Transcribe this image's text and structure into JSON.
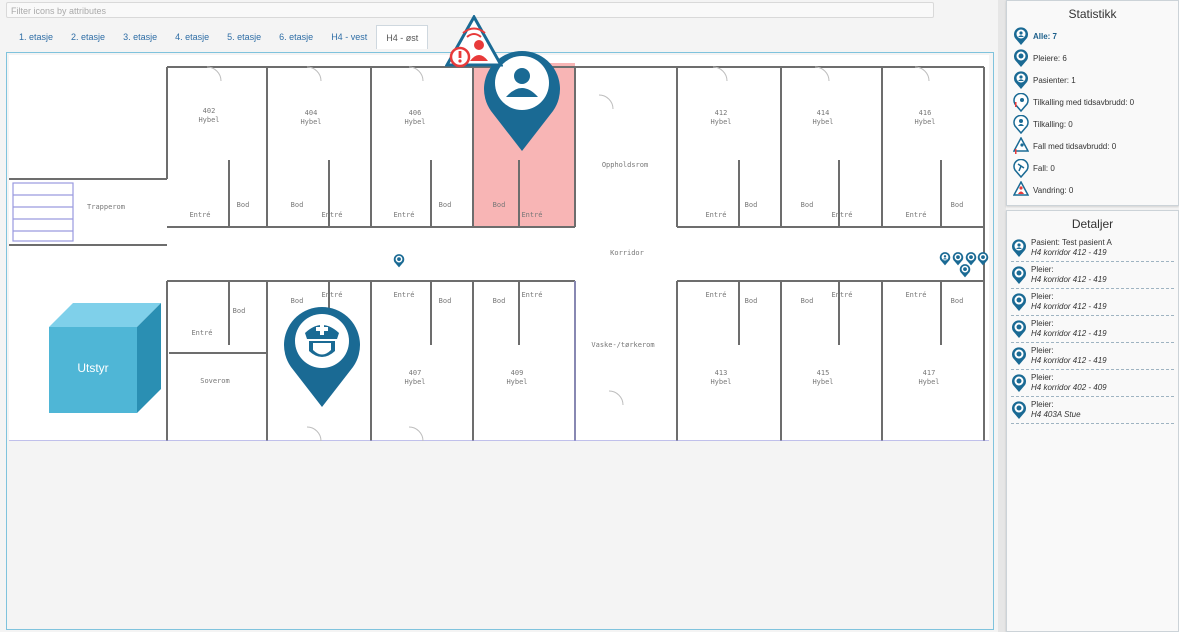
{
  "search": {
    "placeholder": "Filter icons by attributes"
  },
  "tabs": [
    {
      "label": "1. etasje",
      "active": false
    },
    {
      "label": "2. etasje",
      "active": false
    },
    {
      "label": "3. etasje",
      "active": false
    },
    {
      "label": "4. etasje",
      "active": false
    },
    {
      "label": "5. etasje",
      "active": false
    },
    {
      "label": "6. etasje",
      "active": false
    },
    {
      "label": "H4 - vest",
      "active": false
    },
    {
      "label": "H4 - øst",
      "active": true
    }
  ],
  "rooms": {
    "r402": "402",
    "r404": "404",
    "r406": "406",
    "r412": "412",
    "r414": "414",
    "r416": "416",
    "r407": "407",
    "r409": "409",
    "r413": "413",
    "r415": "415",
    "r417": "417",
    "hybel": "Hybel",
    "entre": "Entré",
    "bod": "Bod",
    "trapperom": "Trapperom",
    "oppholdsrom": "Oppholdsrom",
    "korridor": "Korridor",
    "vaske": "Vaske-/tørkerom",
    "soverom": "Soverom"
  },
  "equipment": {
    "label": "Utstyr",
    "color": "#4fb6d6"
  },
  "markers": {
    "patient_icon": "person-icon",
    "nurse_icon": "nurse-icon",
    "alert_icon": "alert-person-icon",
    "brand_color": "#1a6a94",
    "alert_color": "#e83a3a",
    "highlight_color": "#f7a8a8"
  },
  "stats": {
    "title": "Statistikk",
    "items": [
      {
        "label": "Alle: 7",
        "icon": "person-icon",
        "bold": true
      },
      {
        "label": "Pleiere: 6",
        "icon": "nurse-icon"
      },
      {
        "label": "Pasienter: 1",
        "icon": "person-icon"
      },
      {
        "label": "Tilkalling med tidsavbrudd: 0",
        "icon": "call-timeout-icon"
      },
      {
        "label": "Tilkalling: 0",
        "icon": "call-icon"
      },
      {
        "label": "Fall med tidsavbrudd: 0",
        "icon": "fall-timeout-icon"
      },
      {
        "label": "Fall: 0",
        "icon": "fall-icon"
      },
      {
        "label": "Vandring: 0",
        "icon": "wandering-icon"
      }
    ]
  },
  "details": {
    "title": "Detaljer",
    "items": [
      {
        "label": "Pasient: Test pasient A",
        "location": "H4 korridor 412 - 419",
        "icon": "person-icon"
      },
      {
        "label": "Pleier:",
        "location": "H4 korridor 412 - 419",
        "icon": "nurse-icon"
      },
      {
        "label": "Pleier:",
        "location": "H4 korridor 412 - 419",
        "icon": "nurse-icon"
      },
      {
        "label": "Pleier:",
        "location": "H4 korridor 412 - 419",
        "icon": "nurse-icon"
      },
      {
        "label": "Pleier:",
        "location": "H4 korridor 412 - 419",
        "icon": "nurse-icon"
      },
      {
        "label": "Pleier:",
        "location": "H4 korridor 402 - 409",
        "icon": "nurse-icon"
      },
      {
        "label": "Pleier:",
        "location": "H4 403A Stue",
        "icon": "nurse-icon"
      }
    ]
  }
}
